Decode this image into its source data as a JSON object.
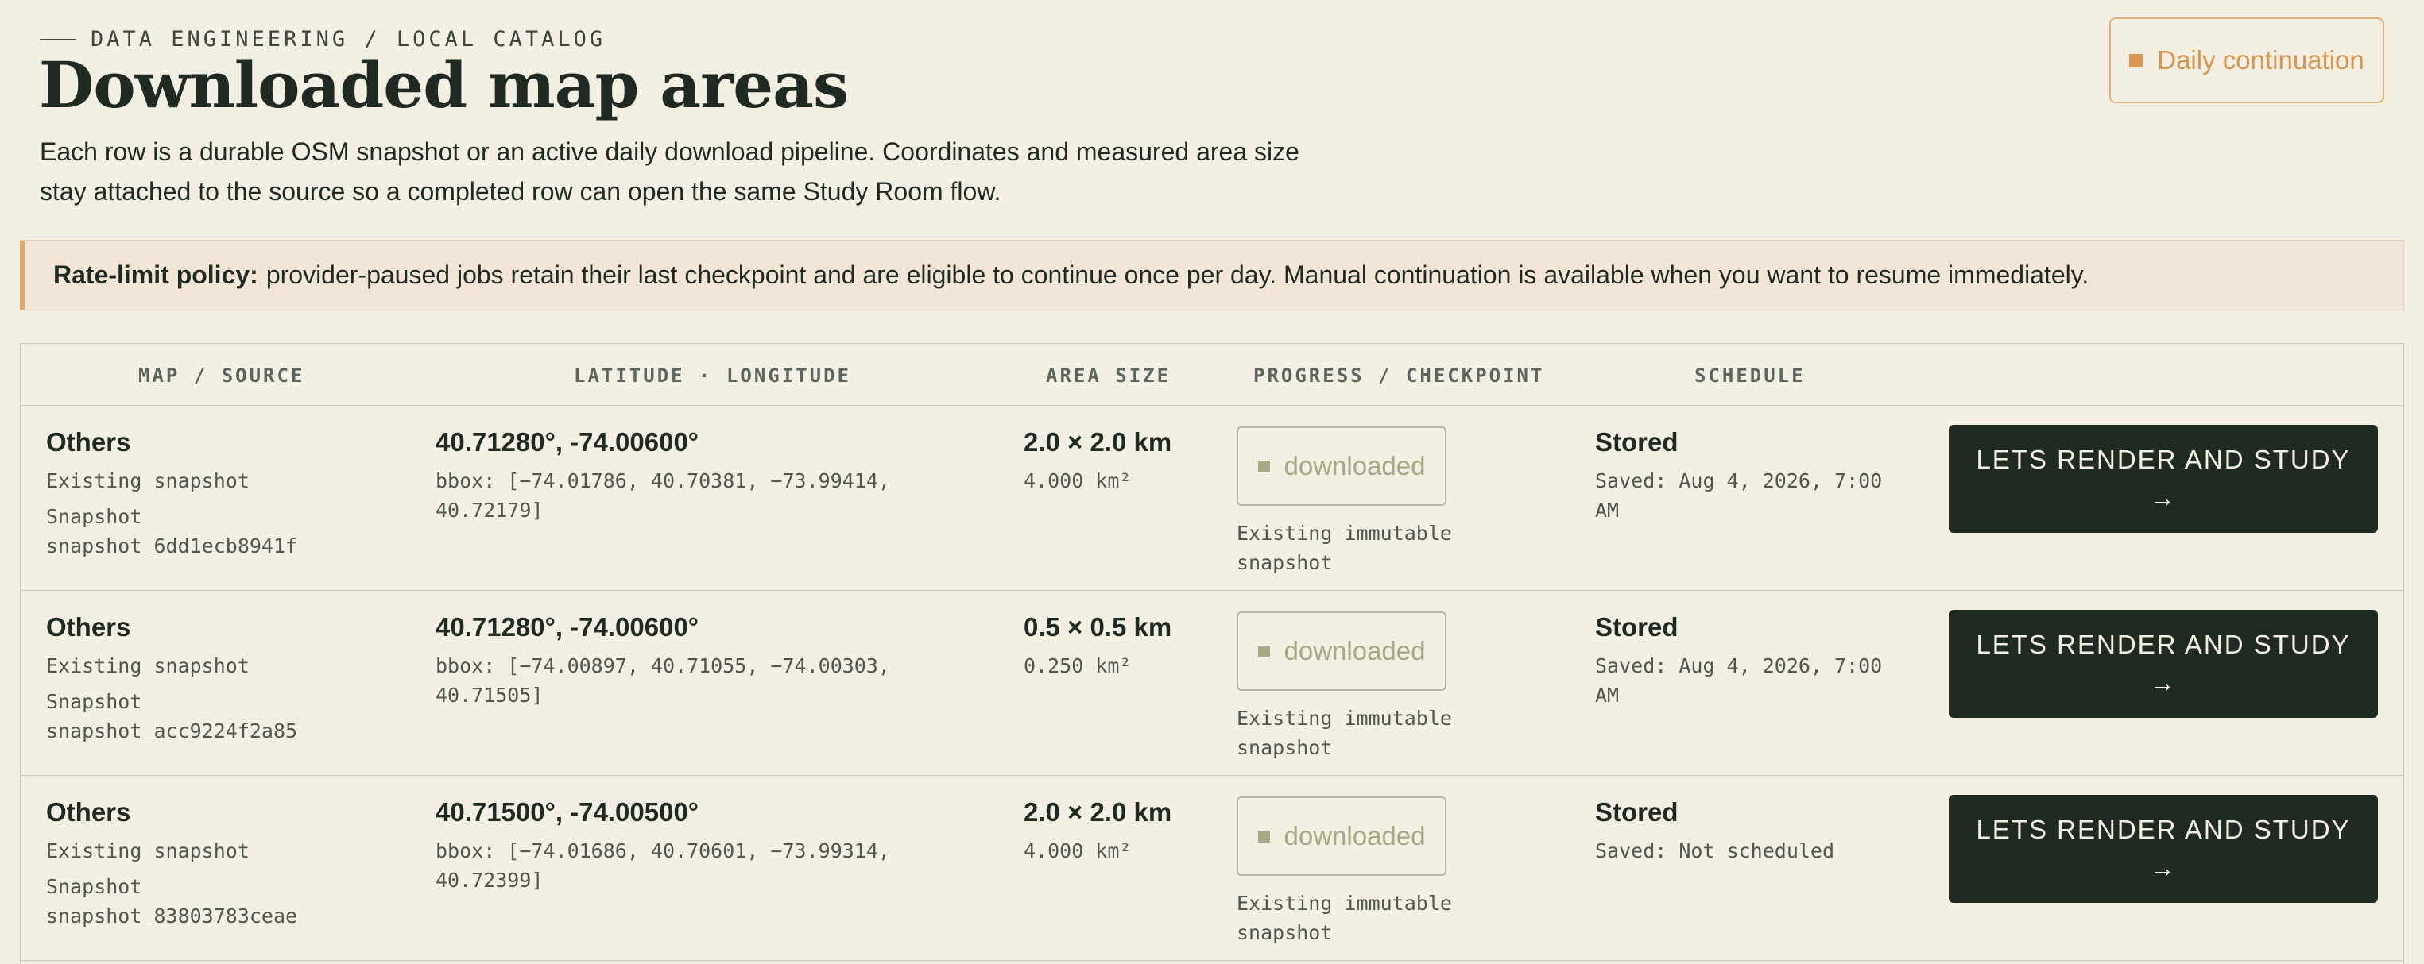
{
  "header": {
    "eyebrow": "DATA ENGINEERING / LOCAL CATALOG",
    "title": "Downloaded map areas",
    "intro_line1": "Each row is a durable OSM snapshot or an active daily download pipeline. Coordinates and measured area size",
    "intro_line2": "stay attached to the source so a completed row can open the same Study Room flow.",
    "daily_button": "Daily continuation"
  },
  "policy": {
    "label": "Rate-limit policy:",
    "text": "provider-paused jobs retain their last checkpoint and are eligible to continue once per day. Manual continuation is available when you want to resume immediately."
  },
  "table": {
    "columns": [
      "MAP / SOURCE",
      "LATITUDE · LONGITUDE",
      "AREA SIZE",
      "PROGRESS / CHECKPOINT",
      "SCHEDULE"
    ],
    "rows": [
      {
        "name": "Others",
        "source": "Existing snapshot",
        "snapshot_label": "Snapshot",
        "snapshot_id": "snapshot_6dd1ecb8941f",
        "coords": "40.71280°, -74.00600°",
        "bbox_line1": "bbox: [−74.01786, 40.70381, −73.99414,",
        "bbox_line2": "40.72179]",
        "area": "2.0 × 2.0 km",
        "area_km2": "4.000 km²",
        "status": "downloaded",
        "checkpoint_line1": "Existing immutable",
        "checkpoint_line2": "snapshot",
        "schedule": "Stored",
        "saved_line1": "Saved: Aug 4, 2026, 7:00",
        "saved_line2": "AM",
        "action_line1": "LETS RENDER AND STUDY",
        "action_arrow": "→"
      },
      {
        "name": "Others",
        "source": "Existing snapshot",
        "snapshot_label": "Snapshot",
        "snapshot_id": "snapshot_acc9224f2a85",
        "coords": "40.71280°, -74.00600°",
        "bbox_line1": "bbox: [−74.00897, 40.71055, −74.00303,",
        "bbox_line2": "40.71505]",
        "area": "0.5 × 0.5 km",
        "area_km2": "0.250 km²",
        "status": "downloaded",
        "checkpoint_line1": "Existing immutable",
        "checkpoint_line2": "snapshot",
        "schedule": "Stored",
        "saved_line1": "Saved: Aug 4, 2026, 7:00",
        "saved_line2": "AM",
        "action_line1": "LETS RENDER AND STUDY",
        "action_arrow": "→"
      },
      {
        "name": "Others",
        "source": "Existing snapshot",
        "snapshot_label": "Snapshot",
        "snapshot_id": "snapshot_83803783ceae",
        "coords": "40.71500°, -74.00500°",
        "bbox_line1": "bbox: [−74.01686, 40.70601, −73.99314,",
        "bbox_line2": "40.72399]",
        "area": "2.0 × 2.0 km",
        "area_km2": "4.000 km²",
        "status": "downloaded",
        "checkpoint_line1": "Existing immutable",
        "checkpoint_line2": "snapshot",
        "schedule": "Stored",
        "saved_line1": "Saved: Not scheduled",
        "saved_line2": "",
        "action_line1": "LETS RENDER AND STUDY",
        "action_arrow": "→"
      }
    ]
  }
}
